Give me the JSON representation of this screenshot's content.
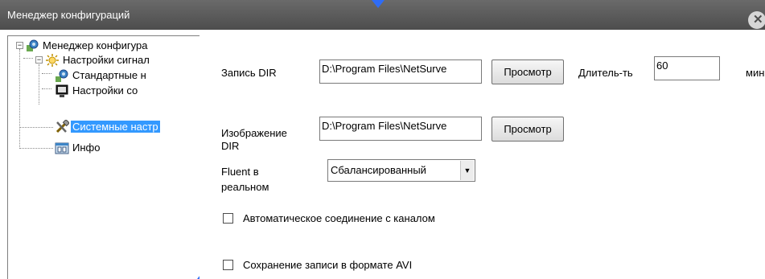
{
  "window": {
    "title": "Менеджер конфигураций",
    "close_glyph": "✕"
  },
  "tree": {
    "root": {
      "label": "Менеджер конфигура",
      "icon": "config-manager-icon",
      "expander": "−"
    },
    "items": [
      {
        "label": "Настройки сигнал",
        "icon": "alarm-settings-icon",
        "expander": "−"
      },
      {
        "label": "Стандартные н",
        "icon": "standard-settings-icon"
      },
      {
        "label": "Настройки со",
        "icon": "monitor-settings-icon"
      },
      {
        "label": "Системные настр",
        "icon": "system-tools-icon",
        "selected": true
      },
      {
        "label": "Инфо",
        "icon": "info-icon"
      }
    ]
  },
  "form": {
    "record_dir": {
      "label": "Запись DIR",
      "value": "D:\\Program Files\\NetSurve",
      "browse_label": "Просмотр"
    },
    "duration": {
      "label": "Длитель-ть",
      "value": "60",
      "unit": "мин"
    },
    "image_dir": {
      "label_line1": "Изображение",
      "label_line2": "DIR",
      "value": "D:\\Program Files\\NetSurve",
      "browse_label": "Просмотр"
    },
    "fluent": {
      "label_line1": "Fluent в",
      "label_line2": "реальном",
      "selected": "Сбалансированный",
      "arrow": "▼"
    },
    "auto_connect": {
      "label": "Автоматическое соединение с каналом",
      "checked": false
    },
    "save_avi": {
      "label": "Сохранение записи в формате AVI",
      "checked": false
    }
  },
  "colors": {
    "titlebar": "#4d4d4d",
    "selection": "#3399ff",
    "watermark_accent": "#2f6cf5"
  }
}
